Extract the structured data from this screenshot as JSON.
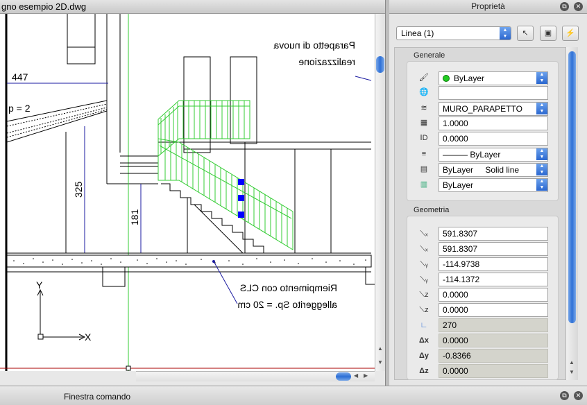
{
  "drawing": {
    "title": "gno esempio 2D.dwg",
    "annotations": {
      "dim_447": "447",
      "dim_325": "325",
      "dim_181": "181",
      "p_label": "p = 2",
      "note_parapet_1": "Parapetto di nuova",
      "note_parapet_2": "realizzazione",
      "note_fill_1": "Riempimento con CLS",
      "note_fill_2": "alleggerito Sp. = 20 cm",
      "axis_x": "X",
      "axis_y": "Y"
    }
  },
  "properties": {
    "title": "Proprietà",
    "selector": "Linea (1)",
    "sections": {
      "general": "Generale",
      "geometry": "Geometria"
    },
    "general": {
      "color": "ByLayer",
      "plot_style": "",
      "layer": "MURO_PARAPETTO",
      "linetype_scale": "1.0000",
      "thickness": "0.0000",
      "lineweight": "——— ByLayer",
      "linetype": "ByLayer",
      "linetype_name": "Solid line",
      "material": "ByLayer"
    },
    "geometry": {
      "start_x": "591.8307",
      "end_x": "591.8307",
      "start_y": "-114.9738",
      "end_y": "-114.1372",
      "start_z": "0.0000",
      "end_z": "0.0000",
      "angle": "270",
      "delta_x": "0.0000",
      "delta_y": "-0.8366",
      "delta_z": "0.0000"
    },
    "geometry_icons": {
      "delta_x": "Δx",
      "delta_y": "Δy",
      "delta_z": "Δz"
    }
  },
  "command_bar": {
    "title": "Finestra comando"
  },
  "colors": {
    "selection_green": "#33cc33",
    "dimension_blue": "#1a1aa0",
    "grip_blue": "#0000ff",
    "accent": "#2d6fd6"
  }
}
